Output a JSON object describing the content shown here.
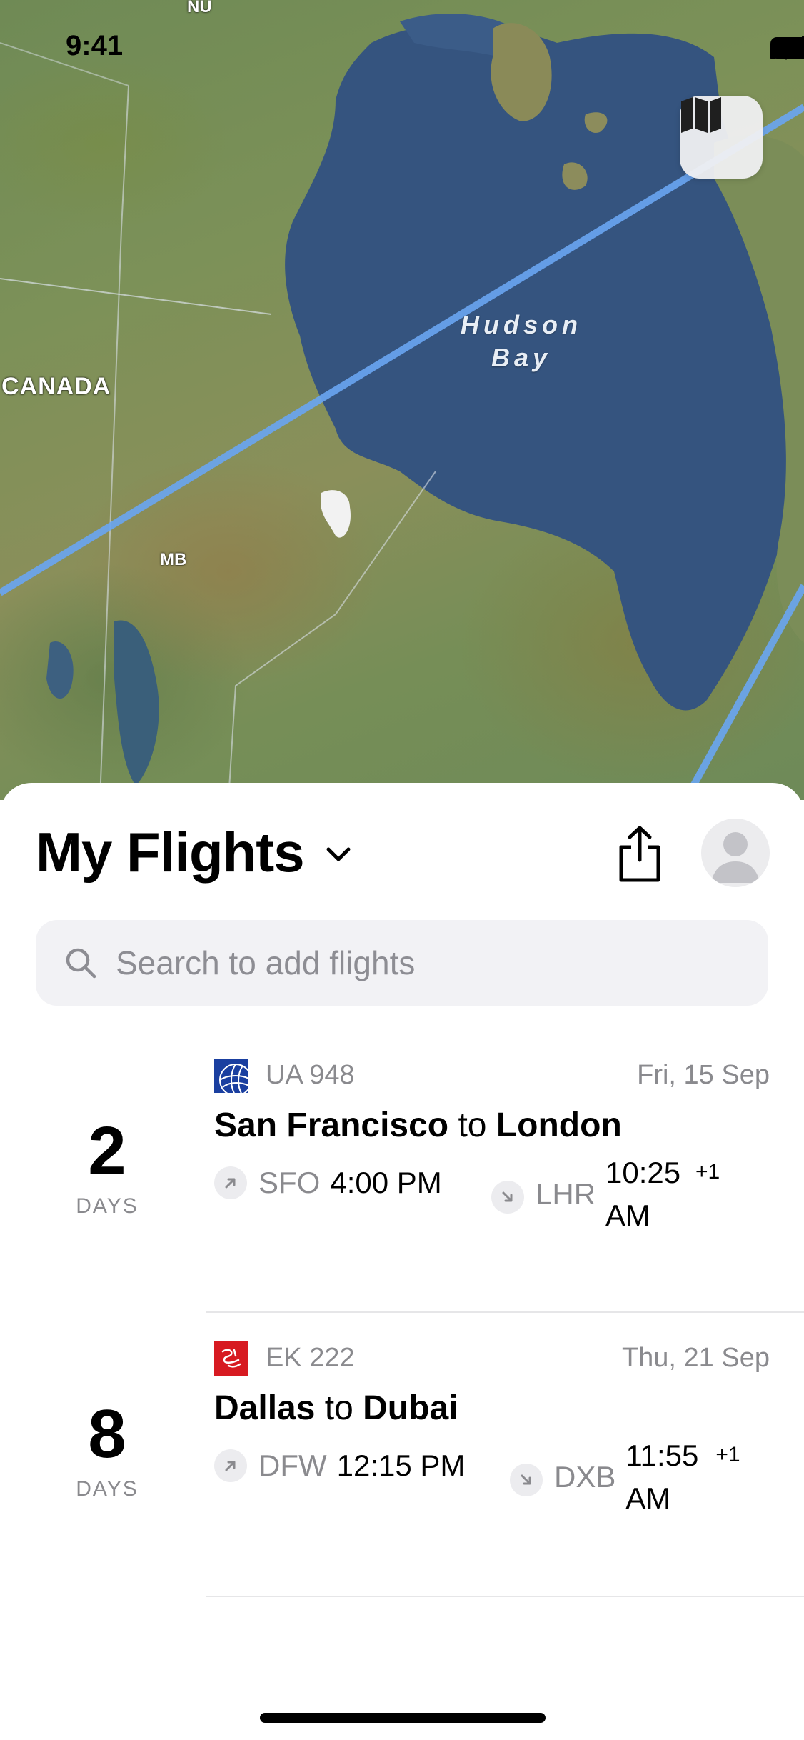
{
  "status_bar": {
    "time": "9:41"
  },
  "map": {
    "labels": {
      "territory": "NU",
      "country": "CANADA",
      "province": "MB",
      "bay_line1": "Hudson",
      "bay_line2": "Bay"
    },
    "toggle_icon": "map-icon"
  },
  "sheet": {
    "title": "My Flights",
    "search_placeholder": "Search to add flights"
  },
  "flights": [
    {
      "days_until": "2",
      "days_label": "DAYS",
      "airline_logo": "united-logo",
      "flight_number": "UA 948",
      "date": "Fri, 15 Sep",
      "origin_city": "San Francisco",
      "connector": "to",
      "destination_city": "London",
      "departure_code": "SFO",
      "departure_time": "4:00 PM",
      "arrival_code": "LHR",
      "arrival_time": "10:25 AM",
      "day_offset": "+1"
    },
    {
      "days_until": "8",
      "days_label": "DAYS",
      "airline_logo": "emirates-logo",
      "flight_number": "EK 222",
      "date": "Thu, 21 Sep",
      "origin_city": "Dallas",
      "connector": "to",
      "destination_city": "Dubai",
      "departure_code": "DFW",
      "departure_time": "12:15 PM",
      "arrival_code": "DXB",
      "arrival_time": "11:55 AM",
      "day_offset": "+1"
    }
  ],
  "colors": {
    "water": "#3a5a85",
    "route_line": "#6aa6f2",
    "emirates_red": "#d71a21",
    "united_blue": "#1a3fa0",
    "secondary_text": "#8a8a8e"
  }
}
